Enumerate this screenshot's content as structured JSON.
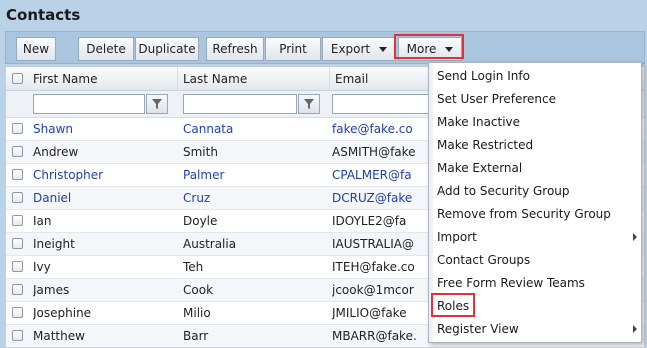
{
  "page": {
    "title": "Contacts"
  },
  "toolbar": {
    "new": "New",
    "delete": "Delete",
    "duplicate": "Duplicate",
    "refresh": "Refresh",
    "print": "Print",
    "export": "Export",
    "more": "More"
  },
  "grid": {
    "columns": [
      "First Name",
      "Last Name",
      "Email"
    ],
    "rows": [
      {
        "first": "Shawn",
        "last": "Cannata",
        "email": "fake@fake.co",
        "link": true
      },
      {
        "first": "Andrew",
        "last": "Smith",
        "email": "ASMITH@fake",
        "link": false
      },
      {
        "first": "Christopher",
        "last": "Palmer",
        "email": "CPALMER@fa",
        "link": true
      },
      {
        "first": "Daniel",
        "last": "Cruz",
        "email": "DCRUZ@fake",
        "link": true
      },
      {
        "first": "Ian",
        "last": "Doyle",
        "email": "IDOYLE2@fa",
        "link": false
      },
      {
        "first": "Ineight",
        "last": "Australia",
        "email": "IAUSTRALIA@",
        "link": false
      },
      {
        "first": "Ivy",
        "last": "Teh",
        "email": "ITEH@fake.co",
        "link": false
      },
      {
        "first": "James",
        "last": "Cook",
        "email": "jcook@1mcor",
        "link": false
      },
      {
        "first": "Josephine",
        "last": "Milio",
        "email": "JMILIO@fake",
        "link": false
      },
      {
        "first": "Matthew",
        "last": "Barr",
        "email": "MBARR@fake.",
        "link": false
      }
    ]
  },
  "more_menu": {
    "items": [
      {
        "label": "Send Login Info",
        "submenu": false
      },
      {
        "label": "Set User Preference",
        "submenu": false
      },
      {
        "label": "Make Inactive",
        "submenu": false
      },
      {
        "label": "Make Restricted",
        "submenu": false
      },
      {
        "label": "Make External",
        "submenu": false
      },
      {
        "label": "Add to Security Group",
        "submenu": false
      },
      {
        "label": "Remove from Security Group",
        "submenu": false
      },
      {
        "label": "Import",
        "submenu": true
      },
      {
        "label": "Contact Groups",
        "submenu": false
      },
      {
        "label": "Free Form Review Teams",
        "submenu": false
      },
      {
        "label": "Roles",
        "submenu": false
      },
      {
        "label": "Register View",
        "submenu": true
      }
    ]
  },
  "colors": {
    "link": "#1f3fae",
    "highlight": "#e0323a",
    "toolbar": "#aac5de"
  }
}
